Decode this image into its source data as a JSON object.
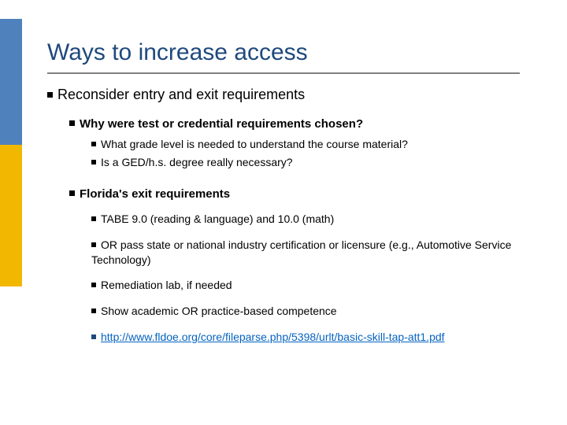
{
  "title": "Ways to increase access",
  "l1": "Reconsider entry and exit requirements",
  "q1": {
    "heading": "Why were test or credential requirements chosen?",
    "items": [
      "What grade level is needed to understand the course material?",
      "Is a GED/h.s. degree really necessary?"
    ]
  },
  "q2": {
    "heading": "Florida's exit requirements",
    "items": [
      "TABE 9.0 (reading & language) and 10.0 (math)",
      "OR pass state or national industry certification or licensure (e.g., Automotive Service Technology)",
      "Remediation lab, if needed",
      "Show academic OR practice-based competence"
    ],
    "link": "http://www.fldoe.org/core/fileparse.php/5398/urlt/basic-skill-tap-att1.pdf"
  }
}
